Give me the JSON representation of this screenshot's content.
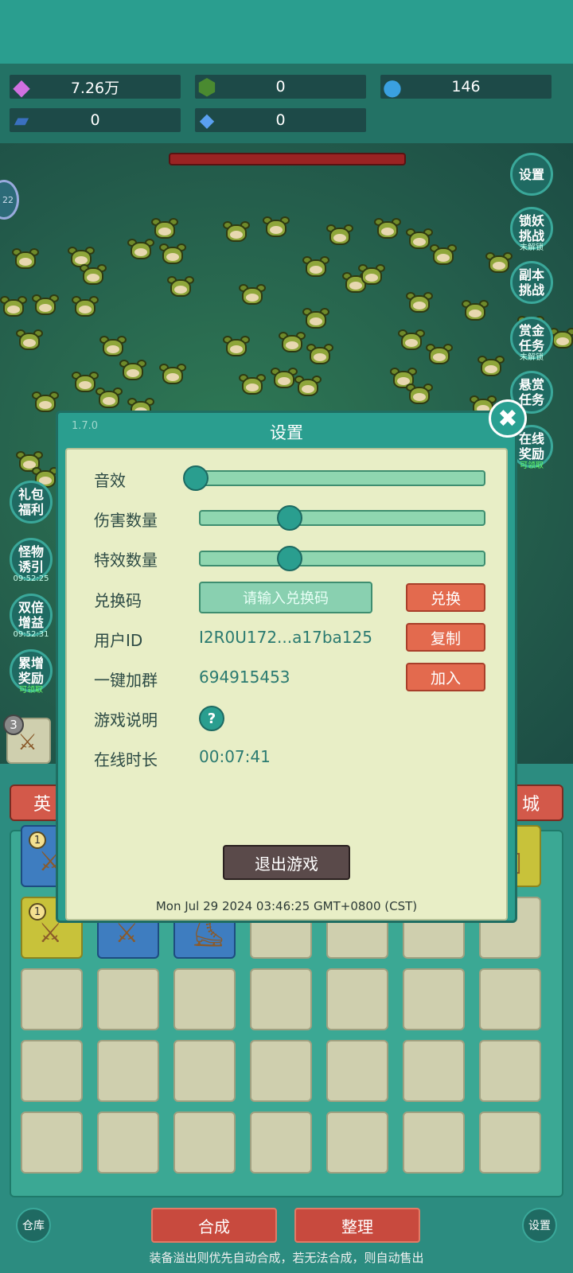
{
  "resources": [
    {
      "icon": "gem-icon",
      "value": "7.26万"
    },
    {
      "icon": "green-crystal-icon",
      "value": "0"
    },
    {
      "icon": "blue-orb-icon",
      "value": "146"
    },
    {
      "icon": "book-icon",
      "value": "0"
    },
    {
      "icon": "blue-shard-icon",
      "value": "0"
    }
  ],
  "side_right": [
    {
      "label": "设置",
      "sub": ""
    },
    {
      "label": "锁妖挑战",
      "sub": "未解锁"
    },
    {
      "label": "副本挑战",
      "sub": ""
    },
    {
      "label": "赏金任务",
      "sub": "未解锁"
    },
    {
      "label": "悬赏任务",
      "sub": ""
    },
    {
      "label": "在线奖励",
      "sub": "可领取"
    }
  ],
  "side_left": [
    {
      "label": "礼包福利",
      "sub": ""
    },
    {
      "label": "怪物诱引",
      "sub": "09:52:25"
    },
    {
      "label": "双倍增益",
      "sub": "09:52:31"
    },
    {
      "label": "累增奖励",
      "sub": "可领取"
    }
  ],
  "level_badge": "22",
  "hand_count": "3",
  "tabs": {
    "left": "英",
    "right": "城"
  },
  "bottom": {
    "storage": "仓库",
    "merge": "合成",
    "sort": "整理",
    "settings": "设置",
    "note": "装备溢出则优先自动合成，若无法合成，则自动售出"
  },
  "dialog": {
    "version": "1.7.0",
    "title": "设置",
    "sound_label": "音效",
    "sound_level": 0,
    "damage_label": "伤害数量",
    "damage_level": 0.3,
    "effects_label": "特效数量",
    "effects_level": 0.3,
    "redeem_label": "兑换码",
    "redeem_placeholder": "请输入兑换码",
    "redeem_button": "兑换",
    "userid_label": "用户ID",
    "userid_value": "I2R0U172...a17ba125",
    "copy_button": "复制",
    "group_label": "一键加群",
    "group_value": "694915453",
    "join_button": "加入",
    "help_label": "游戏说明",
    "help_glyph": "?",
    "online_label": "在线时长",
    "online_value": "00:07:41",
    "exit_button": "退出游戏",
    "datetime": "Mon Jul 29 2024 03:46:25 GMT+0800 (CST)",
    "close_glyph": "✖"
  },
  "colors": {
    "accent": "#2a9e8f",
    "panel": "#e8eec6",
    "red_button": "#e36a4e"
  }
}
